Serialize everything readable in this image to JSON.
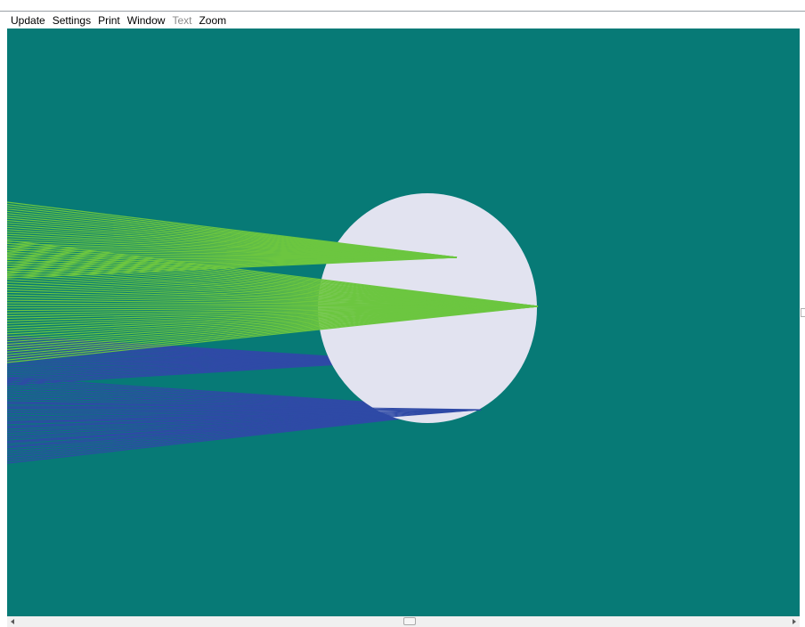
{
  "menubar": {
    "items": [
      {
        "label": "Update",
        "enabled": true
      },
      {
        "label": "Settings",
        "enabled": true
      },
      {
        "label": "Print",
        "enabled": true
      },
      {
        "label": "Window",
        "enabled": true
      },
      {
        "label": "Text",
        "enabled": false
      },
      {
        "label": "Zoom",
        "enabled": true
      }
    ]
  },
  "scene": {
    "background_color": "#077a76",
    "target": {
      "shape": "circle",
      "color": "#e2e3f0"
    },
    "beams": [
      {
        "color": "#6cc640",
        "description": "green ray fan"
      },
      {
        "color": "#2f4aa6",
        "description": "blue ray fan"
      }
    ]
  },
  "scrollbar": {
    "left_arrow_icon": "triangle-left-icon",
    "right_arrow_icon": "triangle-right-icon"
  }
}
